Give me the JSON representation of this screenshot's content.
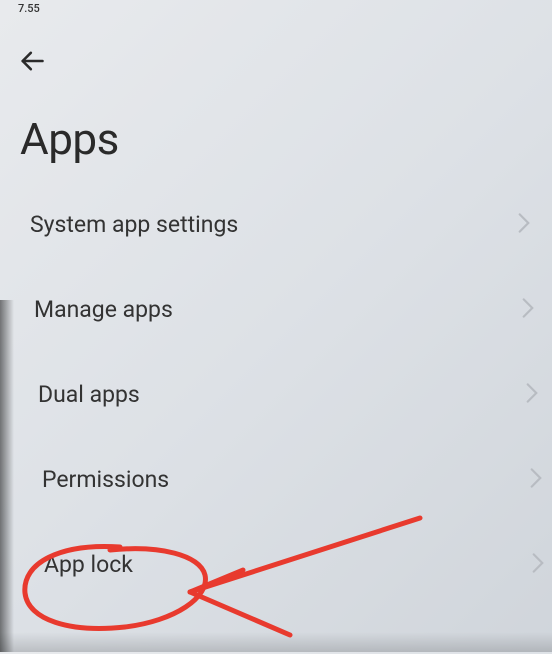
{
  "status_bar": {
    "time_fragment": "7.55"
  },
  "page": {
    "title": "Apps"
  },
  "items": [
    {
      "label": "System app settings"
    },
    {
      "label": "Manage apps"
    },
    {
      "label": "Dual apps"
    },
    {
      "label": "Permissions"
    },
    {
      "label": "App lock"
    }
  ],
  "annotation": {
    "highlight_item": "App lock",
    "color": "#e83a2e"
  }
}
